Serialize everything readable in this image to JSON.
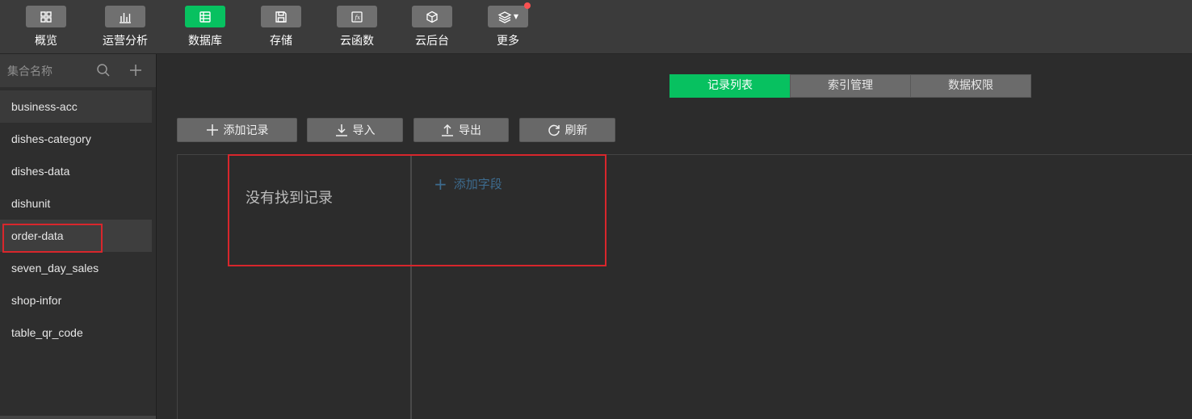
{
  "toolbar": {
    "items": [
      {
        "label": "概览",
        "icon": "grid-icon"
      },
      {
        "label": "运营分析",
        "icon": "bar-chart-icon"
      },
      {
        "label": "数据库",
        "icon": "database-icon"
      },
      {
        "label": "存储",
        "icon": "save-icon"
      },
      {
        "label": "云函数",
        "icon": "function-icon"
      },
      {
        "label": "云后台",
        "icon": "cube-icon"
      },
      {
        "label": "更多",
        "icon": "layers-icon"
      }
    ],
    "active_index": 2
  },
  "sidebar": {
    "title": "集合名称",
    "collections": [
      "business-acc",
      "dishes-category",
      "dishes-data",
      "dishunit",
      "order-data",
      "seven_day_sales",
      "shop-infor",
      "table_qr_code"
    ],
    "selected": "order-data"
  },
  "tabs": [
    "记录列表",
    "索引管理",
    "数据权限"
  ],
  "actions": {
    "add": "添加记录",
    "import": "导入",
    "export": "导出",
    "refresh": "刷新"
  },
  "records": {
    "empty_message": "没有找到记录",
    "add_field": "添加字段"
  },
  "colors": {
    "accent": "#07c160",
    "highlight_box": "#d8262c",
    "badge": "#fa5151"
  }
}
